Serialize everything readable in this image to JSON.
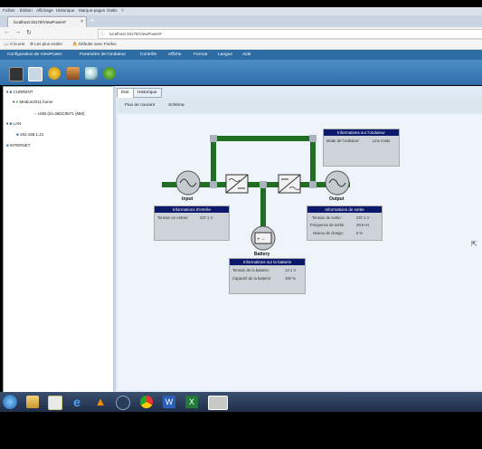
{
  "browser": {
    "menu": [
      "Fichier",
      "Édition",
      "Affichage",
      "Historique",
      "Marque-pages",
      "Outils",
      "?"
    ],
    "tab_title": "localhost:15178/ViewPower#",
    "url": "localhost:15178/ViewPower#",
    "bookmarks": [
      "À la une",
      "Les plus visités",
      "Débuter avec Firefox"
    ]
  },
  "app": {
    "menu": [
      "Configuration de ViewPower",
      "Paramètre de l'onduleur",
      "Contrôle",
      "Affiche",
      "Format",
      "Langue",
      "Aide"
    ],
    "tree": {
      "current": "CURRENT",
      "host": "Medion2011.home",
      "usb": "USB (Id=36DC9571 (MM)",
      "lan": "LAN",
      "ip": "192.168.1.21",
      "internet": "INTERNET"
    },
    "tabs": [
      "État",
      "Historique"
    ],
    "subtabs": [
      "Flux de courant",
      "Schéma"
    ],
    "diagram": {
      "input_label": "Input",
      "output_label": "Output",
      "battery_label": "Battery",
      "input_info": {
        "title": "Informations d'entrée",
        "rows": [
          {
            "k": "Tension en entrée:",
            "v": "237.1 V"
          }
        ]
      },
      "output_info": {
        "title": "Informations de sortie",
        "rows": [
          {
            "k": "Tension de sortie:",
            "v": "237.1 V"
          },
          {
            "k": "Fréquence de sortie:",
            "v": "49.8 Hz"
          },
          {
            "k": "Niveau de charge:",
            "v": "0 %"
          }
        ]
      },
      "ups_info": {
        "title": "Informations sur l'onduleur",
        "rows": [
          {
            "k": "Mode de l'onduleur:",
            "v": "Line mode"
          }
        ]
      },
      "battery_info": {
        "title": "Informations sur la batterie",
        "rows": [
          {
            "k": "Tension de la batterie:",
            "v": "14.1 V"
          },
          {
            "k": "Capacité de la batterie:",
            "v": "100 %"
          }
        ]
      }
    }
  },
  "colors": {
    "app_menu": "#2e6da4",
    "info_header": "#0d1a6b",
    "power_line": "#1f6e22",
    "panel_bg": "#dfeaf4"
  },
  "taskbar_icons": [
    "start-orb-icon",
    "explorer-icon",
    "media-center-icon",
    "ie-icon",
    "vlc-icon",
    "firefox-icon",
    "chrome-icon",
    "word-icon",
    "excel-icon",
    "ups-app-icon"
  ]
}
